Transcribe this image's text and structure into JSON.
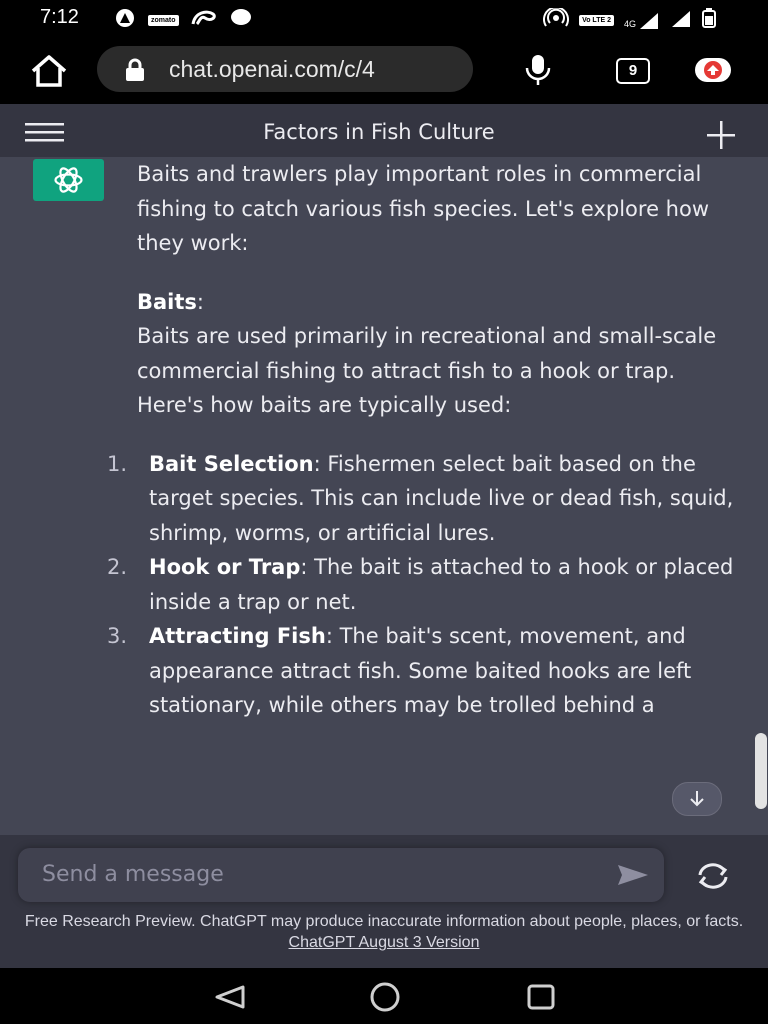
{
  "status_bar": {
    "time": "7:12",
    "left_icons": [
      "app-a-icon",
      "zomato-icon",
      "airtel-icon",
      "chat-bubble-icon"
    ],
    "zomato_label": "zomato",
    "network_label": "4G",
    "volte_label": "Vo LTE 2",
    "right_icons": [
      "hotspot-icon",
      "volte-icon",
      "signal-4g-icon",
      "signal-icon",
      "battery-icon"
    ]
  },
  "browser": {
    "url": "chat.openai.com/c/4",
    "tab_count": "9",
    "icons": [
      "home-icon",
      "lock-icon",
      "mic-icon",
      "tabs-icon",
      "update-icon"
    ]
  },
  "header": {
    "title": "Factors in Fish Culture",
    "icons": [
      "menu-icon",
      "plus-icon"
    ]
  },
  "message": {
    "intro": "Baits and trawlers play important roles in commercial fishing to catch various fish species. Let's explore how they work:",
    "section_heading": "Baits",
    "section_heading_suffix": ":",
    "section_body": "Baits are used primarily in recreational and small-scale commercial fishing to attract fish to a hook or trap. Here's how baits are typically used:",
    "list": [
      {
        "num": "1.",
        "title": "Bait Selection",
        "text": ": Fishermen select bait based on the target species. This can include live or dead fish, squid, shrimp, worms, or artificial lures."
      },
      {
        "num": "2.",
        "title": "Hook or Trap",
        "text": ": The bait is attached to a hook or placed inside a trap or net."
      },
      {
        "num": "3.",
        "title": "Attracting Fish",
        "text": ": The bait's scent, movement, and appearance attract fish. Some baited hooks are left stationary, while others may be trolled behind a"
      }
    ]
  },
  "composer": {
    "placeholder": "Send a message",
    "disclaimer_text": "Free Research Preview. ChatGPT may produce inaccurate information about people, places, or facts. ",
    "disclaimer_link": "ChatGPT August 3 Version"
  },
  "nav_bar": {
    "icons": [
      "back-triangle-icon",
      "home-circle-icon",
      "recents-square-icon"
    ]
  },
  "colors": {
    "accent": "#10a37f",
    "background": "#444654",
    "header": "#343541",
    "input": "#40414f"
  }
}
